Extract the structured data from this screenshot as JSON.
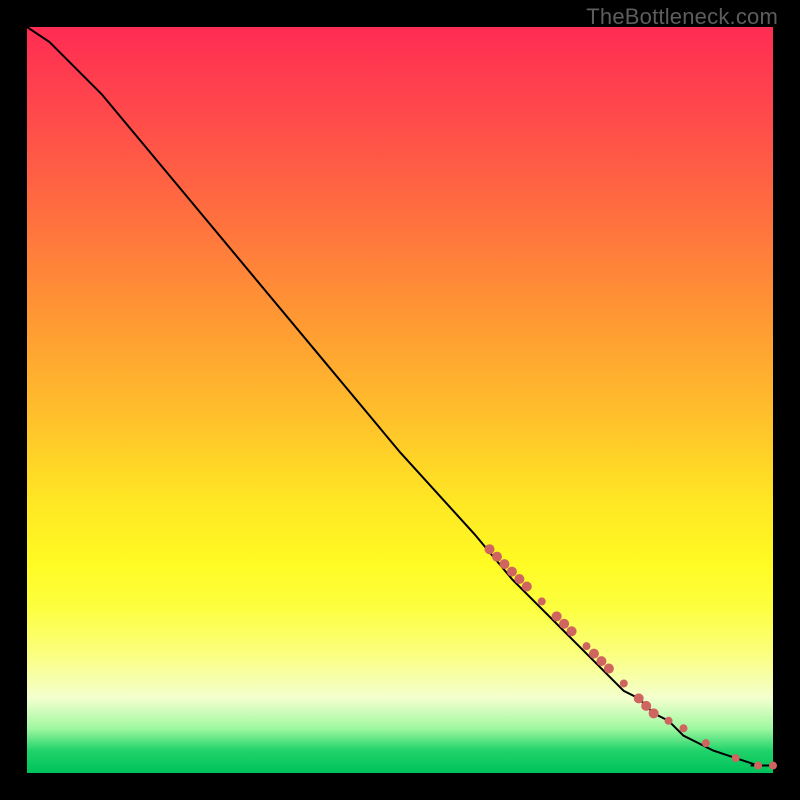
{
  "watermark": "TheBottleneck.com",
  "colors": {
    "page_bg": "#000000",
    "line": "#000000",
    "marker": "#d0645e",
    "gradient_top": "#ff2c53",
    "gradient_bottom": "#00c25a"
  },
  "chart_data": {
    "type": "line",
    "title": "",
    "xlabel": "",
    "ylabel": "",
    "xlim": [
      0,
      100
    ],
    "ylim": [
      0,
      100
    ],
    "x": [
      0,
      3,
      6,
      10,
      15,
      20,
      30,
      40,
      50,
      60,
      65,
      70,
      72,
      74,
      76,
      78,
      80,
      82,
      84,
      86,
      88,
      90,
      92,
      95,
      98,
      100
    ],
    "curve_y": [
      100,
      98,
      95,
      91,
      85,
      79,
      67,
      55,
      43,
      32,
      26,
      21,
      19,
      17,
      15,
      13,
      11,
      10,
      8,
      7,
      5,
      4,
      3,
      2,
      1,
      1
    ],
    "markers": [
      {
        "x": 62,
        "y": 30,
        "r": 5
      },
      {
        "x": 63,
        "y": 29,
        "r": 5
      },
      {
        "x": 64,
        "y": 28,
        "r": 5
      },
      {
        "x": 65,
        "y": 27,
        "r": 5
      },
      {
        "x": 66,
        "y": 26,
        "r": 5
      },
      {
        "x": 67,
        "y": 25,
        "r": 5
      },
      {
        "x": 69,
        "y": 23,
        "r": 4
      },
      {
        "x": 71,
        "y": 21,
        "r": 5
      },
      {
        "x": 72,
        "y": 20,
        "r": 5
      },
      {
        "x": 73,
        "y": 19,
        "r": 5
      },
      {
        "x": 75,
        "y": 17,
        "r": 4
      },
      {
        "x": 76,
        "y": 16,
        "r": 5
      },
      {
        "x": 77,
        "y": 15,
        "r": 5
      },
      {
        "x": 78,
        "y": 14,
        "r": 5
      },
      {
        "x": 80,
        "y": 12,
        "r": 4
      },
      {
        "x": 82,
        "y": 10,
        "r": 5
      },
      {
        "x": 83,
        "y": 9,
        "r": 5
      },
      {
        "x": 84,
        "y": 8,
        "r": 5
      },
      {
        "x": 86,
        "y": 7,
        "r": 4
      },
      {
        "x": 88,
        "y": 6,
        "r": 4
      },
      {
        "x": 91,
        "y": 4,
        "r": 4
      },
      {
        "x": 95,
        "y": 2,
        "r": 4
      },
      {
        "x": 98,
        "y": 1,
        "r": 4
      },
      {
        "x": 100,
        "y": 1,
        "r": 4
      }
    ]
  }
}
